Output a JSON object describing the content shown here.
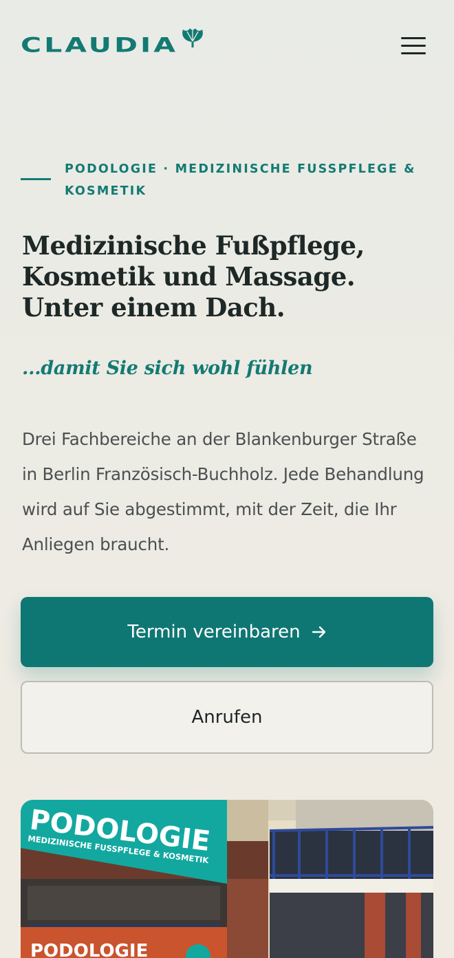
{
  "header": {
    "logo_text": "CLAUDIA",
    "menu_label": "menu"
  },
  "hero": {
    "eyebrow": "Podologie · Medizinische Fusspflege & Kosmetik",
    "headline": "Medizinische Fußpflege, Kosmetik und Massage. Unter einem Dach.",
    "tagline": "...damit Sie sich wohl fühlen",
    "intro": "Drei Fachbereiche an der Blankenburger Straße in Berlin Französisch-Buchholz. Jede Behandlung wird auf Sie abgestimmt, mit der Zeit, die Ihr Anliegen braucht."
  },
  "actions": {
    "primary_label": "Termin vereinbaren",
    "secondary_label": "Anrufen"
  },
  "photo": {
    "sign_title": "PODOLOGIE",
    "sign_subtitle": "MEDIZINISCHE FUSSPFLEGE & KOSMETIK",
    "window_text": "PODOLOGIE"
  },
  "colors": {
    "accent": "#0f7773",
    "heading": "#1d2827",
    "body_text": "#4a5050",
    "background": "#ecebe4"
  },
  "icons": {
    "menu": "hamburger-menu-icon",
    "arrow": "arrow-right-icon",
    "logo": "ginkgo-leaf-icon"
  }
}
